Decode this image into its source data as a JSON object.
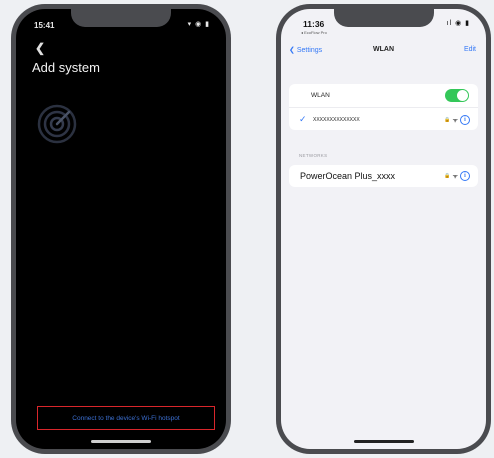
{
  "left_phone": {
    "status_time": "15:41",
    "status_icons": "▾ ◉ ▮",
    "back_icon": "chevron-left-icon",
    "title": "Add system",
    "connect_link": "Connect to the device's Wi-Fi hotspot",
    "highlight_color": "#d9262b"
  },
  "right_phone": {
    "status_time": "11:36",
    "status_carrier": "◂ EcoFlow Pro",
    "status_icons": "ıl ◉ ▮",
    "nav": {
      "back_label": "Settings",
      "title": "WLAN",
      "edit_label": "Edit"
    },
    "wlan_row": {
      "label": "WLAN",
      "toggle_on": true
    },
    "connected_network": {
      "check": "✓",
      "ssid": "XXXXXXXXXXXXXX",
      "lock": "🔒",
      "wifi": "ᯤ",
      "info": "i"
    },
    "networks_header": "NETWORKS",
    "networks": [
      {
        "name": "PowerOcean Plus_xxxx",
        "lock": "🔒",
        "wifi": "ᯤ",
        "info": "i"
      }
    ],
    "accent_color": "#3478f6",
    "toggle_color": "#34c759"
  }
}
